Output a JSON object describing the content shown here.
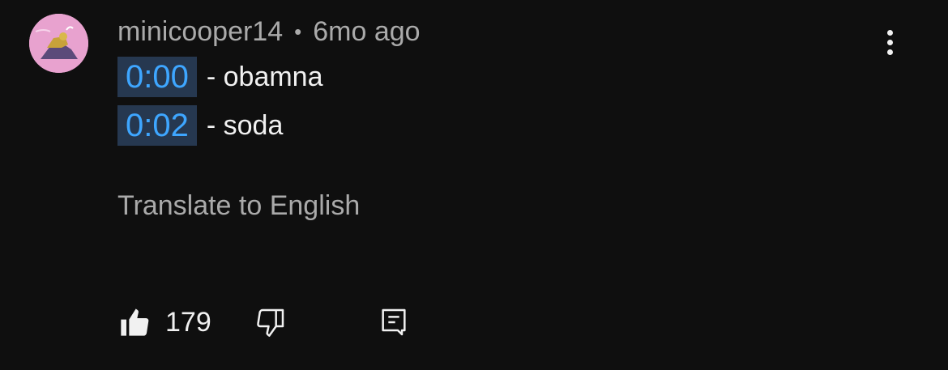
{
  "comment": {
    "author": "minicooper14",
    "separator": "•",
    "time_ago": "6mo ago",
    "lines": [
      {
        "timestamp": "0:00",
        "text": "- obamna"
      },
      {
        "timestamp": "0:02",
        "text": "- soda"
      }
    ],
    "translate_label": "Translate to English"
  },
  "actions": {
    "like_count": "179",
    "like_icon": "thumbs-up-icon",
    "dislike_icon": "thumbs-down-icon",
    "reply_icon": "comment-reply-icon",
    "more_icon": "vertical-dots-icon"
  },
  "colors": {
    "background": "#0f0f0f",
    "timestamp_link": "#3ea6ff",
    "timestamp_bg": "#263850",
    "primary_text": "#f1f1f1",
    "secondary_text": "#aaaaaa",
    "avatar_bg": "#e8a2cf"
  }
}
